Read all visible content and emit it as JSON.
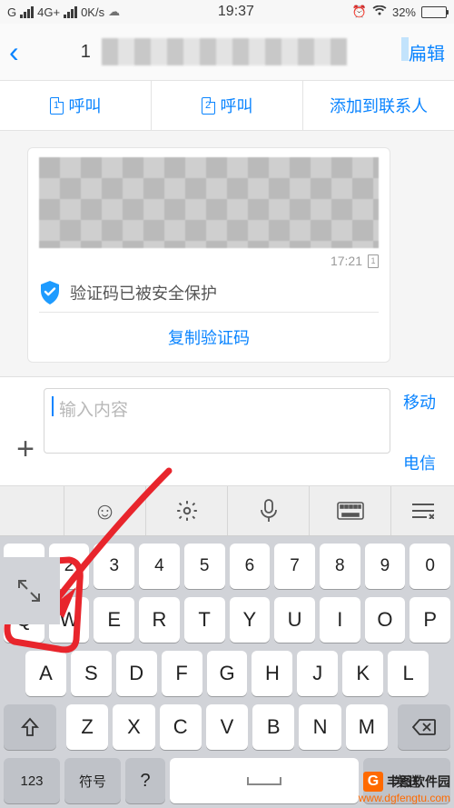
{
  "status": {
    "carrier": "G",
    "net": "4G+",
    "speed": "0K/s",
    "time": "19:37",
    "battery_pct": "32%"
  },
  "header": {
    "title_prefix": "1",
    "edit": "扁辑"
  },
  "actions": {
    "sim1": "1",
    "call1": "呼叫",
    "sim2": "2",
    "call2": "呼叫",
    "add": "添加到联系人"
  },
  "message": {
    "time": "17:21",
    "sim": "1",
    "protected": "验证码已被安全保护",
    "copy": "复制验证码"
  },
  "input": {
    "placeholder": "输入内容",
    "send1": "移动",
    "send2": "电信",
    "plus": "+"
  },
  "kb": {
    "numbers": [
      "1",
      "2",
      "3",
      "4",
      "5",
      "6",
      "7",
      "8",
      "9",
      "0"
    ],
    "row1": [
      "Q",
      "W",
      "E",
      "R",
      "T",
      "Y",
      "U",
      "I",
      "O",
      "P"
    ],
    "row2": [
      "A",
      "S",
      "D",
      "F",
      "G",
      "H",
      "J",
      "K",
      "L"
    ],
    "row3": [
      "Z",
      "X",
      "C",
      "V",
      "B",
      "N",
      "M"
    ],
    "key123": "123",
    "keysym": "符号",
    "keysend": "发送",
    "question": "?"
  },
  "watermark": {
    "brand": "丰图软件园",
    "url": "www.dgfengtu.com"
  }
}
